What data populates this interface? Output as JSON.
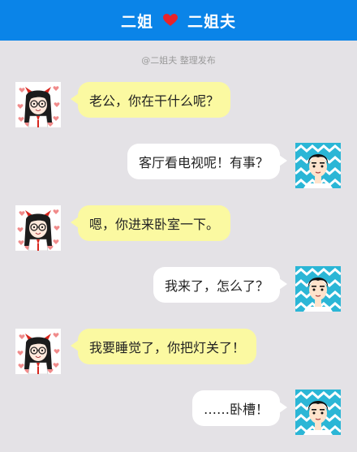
{
  "header": {
    "left_name": "二姐",
    "right_name": "二姐夫",
    "heart_icon": "heart-icon",
    "background": "#0a84e8"
  },
  "credit": "@二姐夫 整理发布",
  "messages": [
    {
      "side": "left",
      "sender": "her",
      "text": "老公，你在干什么呢？"
    },
    {
      "side": "right",
      "sender": "him",
      "text": "客厅看电视呢！有事？"
    },
    {
      "side": "left",
      "sender": "her",
      "text": "嗯，你进来卧室一下。"
    },
    {
      "side": "right",
      "sender": "him",
      "text": "我来了，怎么了？"
    },
    {
      "side": "left",
      "sender": "her",
      "text": "我要睡觉了，你把灯关了！"
    },
    {
      "side": "right",
      "sender": "him",
      "text": "……卧槽！"
    }
  ],
  "colors": {
    "left_bubble": "#fbf9a1",
    "right_bubble": "#ffffff",
    "page_bg": "#e4e2e6"
  }
}
